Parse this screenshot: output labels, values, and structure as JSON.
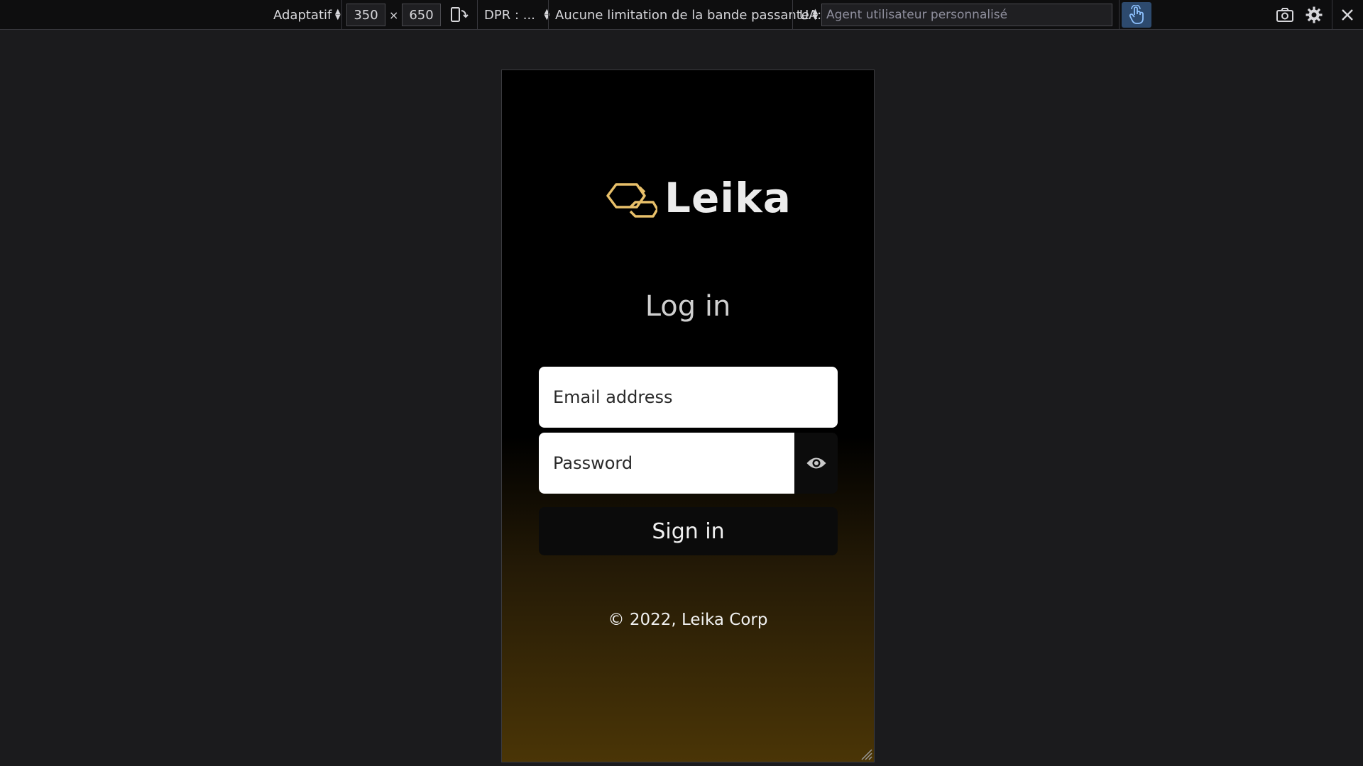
{
  "toolbar": {
    "device_label": "Adaptatif",
    "width_value": "350",
    "times_sign": "×",
    "height_value": "650",
    "dpr_label": "DPR : ...",
    "throttling_label": "Aucune limitation de la bande passante",
    "ua_label": "UA:",
    "ua_placeholder": "Agent utilisateur personnalisé",
    "icons": {
      "rotate": "rotate-device-icon",
      "touch": "touch-simulation-icon",
      "screenshot": "screenshot-icon",
      "settings": "gear-icon",
      "close": "close-icon"
    },
    "colors": {
      "background": "#0e0e0f",
      "text": "#d7d7db",
      "touch_active": "#2d4a6e"
    }
  },
  "app": {
    "brand": "Leika",
    "logo_icon": "hexagon-logo-icon",
    "heading": "Log in",
    "email_placeholder": "Email address",
    "password_placeholder": "Password",
    "toggle_password_icon": "eye-icon",
    "signin_label": "Sign in",
    "footer": "© 2022, Leika Corp",
    "colors": {
      "accent_gold": "#e8c06a",
      "gradient_top": "#000000",
      "gradient_bottom": "#4a3506"
    }
  }
}
